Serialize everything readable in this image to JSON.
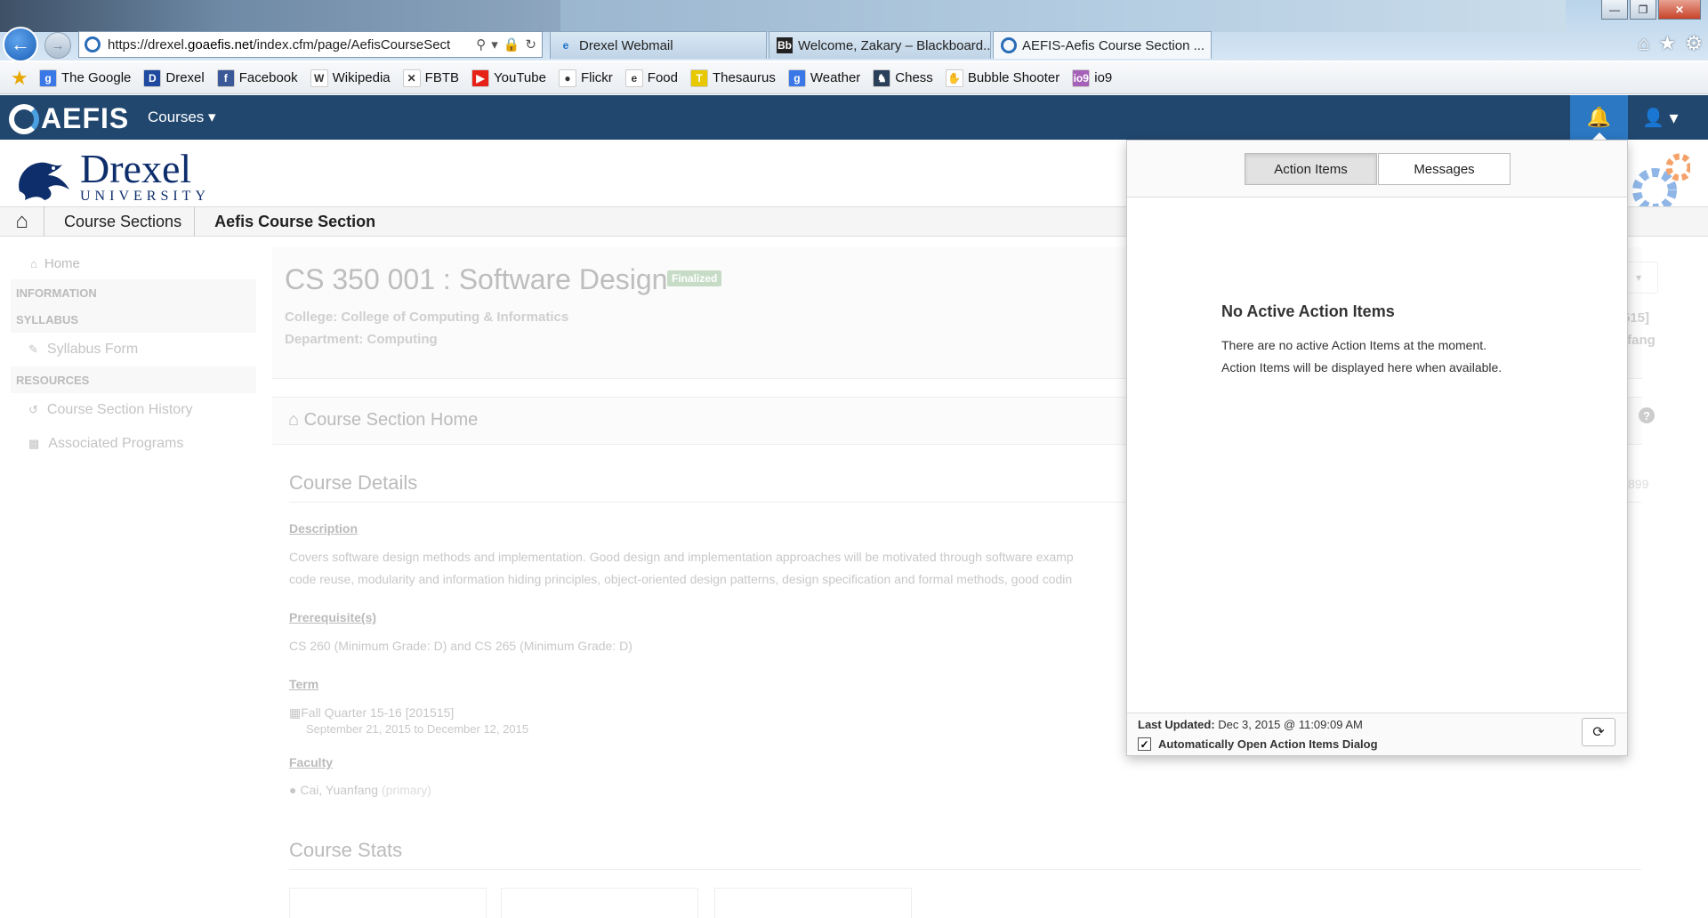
{
  "browser": {
    "window_buttons": {
      "minimize": "—",
      "maximize": "❐",
      "close": "✕"
    },
    "address": {
      "url_prefix": "https://drexel.",
      "url_domain": "goaefis.net",
      "url_path": "/index.cfm/page/AefisCourseSect"
    },
    "tabs": [
      {
        "label": "Drexel Webmail",
        "icon": "ie-icon"
      },
      {
        "label": "Welcome, Zakary – Blackboard...",
        "icon": "blackboard-icon"
      },
      {
        "label": "AEFIS-Aefis Course Section ...",
        "icon": "aefis-icon",
        "close": "✕"
      }
    ],
    "favorites": [
      {
        "label": "The Google",
        "icon": "g",
        "color": "#3b78e7"
      },
      {
        "label": "Drexel",
        "icon": "D",
        "color": "#1f4aa0"
      },
      {
        "label": "Facebook",
        "icon": "f",
        "color": "#3b5998"
      },
      {
        "label": "Wikipedia",
        "icon": "W",
        "color": "#ffffff"
      },
      {
        "label": "FBTB",
        "icon": "✕",
        "color": "#ffffff"
      },
      {
        "label": "YouTube",
        "icon": "▶",
        "color": "#e62117"
      },
      {
        "label": "Flickr",
        "icon": "●",
        "color": "#ffffff"
      },
      {
        "label": "Food",
        "icon": "e",
        "color": "#ffffff"
      },
      {
        "label": "Thesaurus",
        "icon": "T",
        "color": "#e8c800"
      },
      {
        "label": "Weather",
        "icon": "g",
        "color": "#3b78e7"
      },
      {
        "label": "Chess",
        "icon": "♞",
        "color": "#2a3f5a"
      },
      {
        "label": "Bubble Shooter",
        "icon": "✋",
        "color": "#ffffff"
      },
      {
        "label": "io9",
        "icon": "io9",
        "color": "#a561b8"
      }
    ]
  },
  "app": {
    "brand": "AEFIS",
    "nav_courses": "Courses ▾",
    "bell": "🔔",
    "user": "👤 ▾",
    "colors": {
      "navbar": "#21476f",
      "bell_active": "#2c78c2"
    }
  },
  "logo": {
    "line1": "Drexel",
    "line2": "UNIVERSITY"
  },
  "breadcrumb": {
    "home_icon": "⌂",
    "items": [
      "Course Sections",
      "Aefis Course Section"
    ]
  },
  "sidebar": {
    "home": "Home",
    "information": "INFORMATION",
    "syllabus": "SYLLABUS",
    "syllabus_form": "Syllabus Form",
    "resources": "RESOURCES",
    "history": "Course Section History",
    "programs": "Associated Programs"
  },
  "course": {
    "title": "CS 350 001 : Software Design",
    "status": "Finalized",
    "college": "College: College of Computing & Informatics",
    "department": "Department: Computing",
    "partial_right_1": "515]",
    "partial_right_2": "nfang",
    "partial_right_3": "899",
    "section_home": "Course Section Home",
    "details_title": "Course Details",
    "description_label": "Description",
    "description_1": "Covers software design methods and implementation. Good design and implementation approaches will be motivated through software examp",
    "description_2": "code reuse, modularity and information hiding principles, object-oriented design patterns, design specification and formal methods, good codin",
    "prereq_label": "Prerequisite(s)",
    "prereq": "CS 260 (Minimum Grade: D) and CS 265 (Minimum Grade: D)",
    "term_label": "Term",
    "term": "Fall Quarter 15-16 [201515]",
    "term_dates": "September 21, 2015 to December 12, 2015",
    "faculty_label": "Faculty",
    "faculty": "Cai, Yuanfang",
    "faculty_role": "(primary)",
    "stats_title": "Course Stats"
  },
  "panel": {
    "tab_action_items": "Action Items",
    "tab_messages": "Messages",
    "empty_title": "No Active Action Items",
    "empty_line1": "There are no active Action Items at the moment.",
    "empty_line2": "Action Items will be displayed here when available.",
    "last_updated_label": "Last Updated:",
    "last_updated_value": "Dec 3, 2015 @ 11:09:09 AM",
    "auto_open_label": "Automatically Open Action Items Dialog",
    "auto_open_checked": true,
    "refresh_icon": "⟳"
  }
}
